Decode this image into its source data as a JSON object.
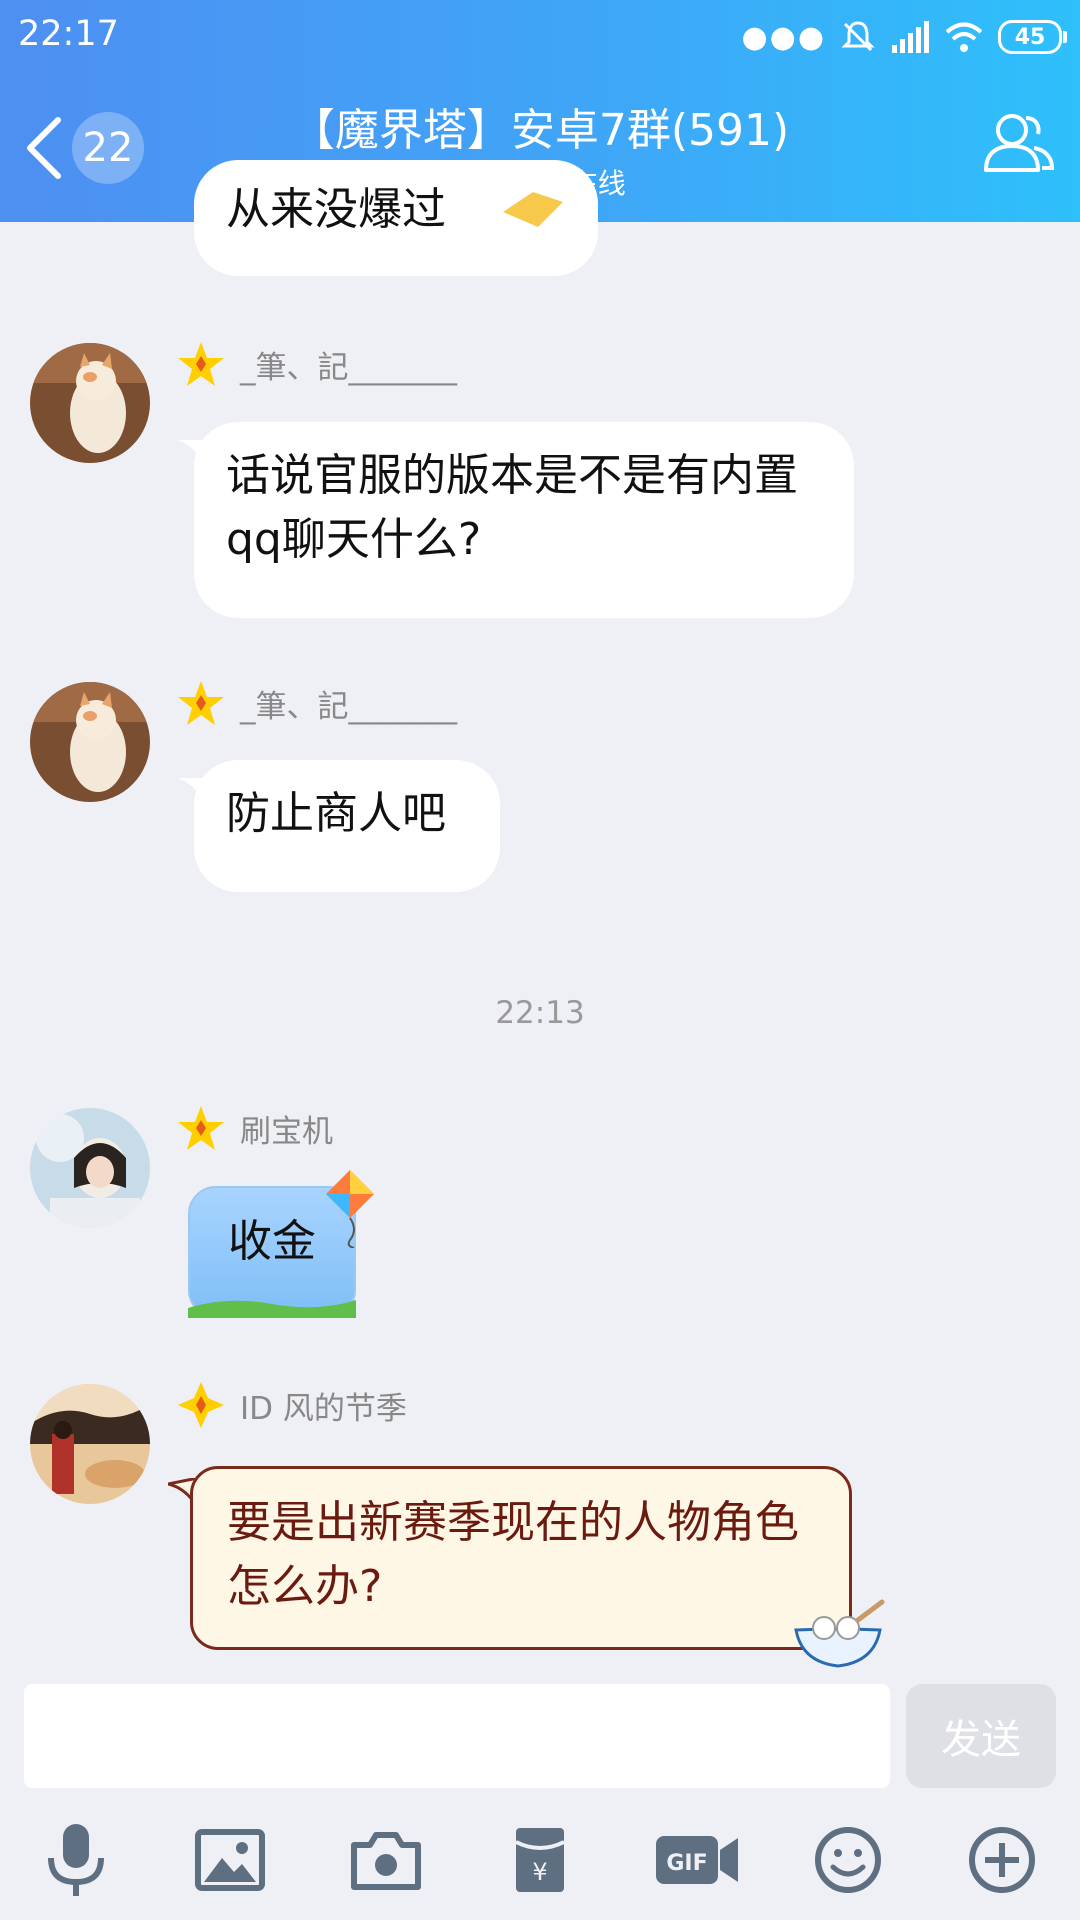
{
  "status_bar": {
    "time": "22:17",
    "battery": "45"
  },
  "header": {
    "unread_count": "22",
    "title": "【魔界塔】安卓7群(591)",
    "online_text": "465人在线"
  },
  "messages": [
    {
      "text": "从来没爆过"
    },
    {
      "sender": "_筆、記_______",
      "text": "话说官服的版本是不是有内置qq聊天什么?"
    },
    {
      "sender": "_筆、記_______",
      "text": "防止商人吧"
    },
    {
      "sender": "刷宝机",
      "text": "收金"
    },
    {
      "sender": "ID 风的节季",
      "text": "要是出新赛季现在的人物角色怎么办?"
    }
  ],
  "timestamp": "22:13",
  "composer": {
    "send_label": "发送"
  },
  "colors": {
    "header_start": "#4e8ff2",
    "header_end": "#2ec0fb",
    "background": "#eff0f5",
    "bubble_brown_text": "#6b1a0f",
    "star": "#ffcf00"
  }
}
